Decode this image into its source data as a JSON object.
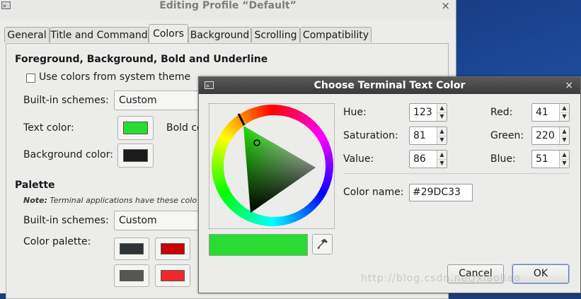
{
  "main_window": {
    "title": "Editing Profile “Default”",
    "close_glyph": "×",
    "tabs": [
      {
        "label": "General"
      },
      {
        "label": "Title and Command"
      },
      {
        "label": "Colors"
      },
      {
        "label": "Background"
      },
      {
        "label": "Scrolling"
      },
      {
        "label": "Compatibility"
      }
    ],
    "active_tab": "Colors",
    "section_fg": "Foreground, Background, Bold and Underline",
    "use_system_colors": {
      "label": "Use colors from system theme",
      "checked": false
    },
    "builtin_schemes_label": "Built-in schemes:",
    "builtin_schemes_value": "Custom",
    "text_color_label": "Text color:",
    "text_color": "#29DC33",
    "bold_label": "Bold co",
    "background_color_label": "Background color:",
    "background_color": "#1b1b1b",
    "palette_heading": "Palette",
    "palette_note_prefix": "Note:",
    "palette_note": " Terminal applications have these colo",
    "palette_schemes_label": "Built-in schemes:",
    "palette_schemes_value": "Custom",
    "color_palette_label": "Color palette:",
    "palette_colors": [
      "#2e3436",
      "#cc0000",
      "#555753",
      "#ef2929"
    ]
  },
  "dialog": {
    "title": "Choose Terminal Text Color",
    "close_glyph": "×",
    "fields": {
      "hue": {
        "label": "Hue:",
        "value": "123"
      },
      "saturation": {
        "label": "Saturation:",
        "value": "81"
      },
      "value": {
        "label": "Value:",
        "value": "86"
      },
      "red": {
        "label": "Red:",
        "value": "41"
      },
      "green": {
        "label": "Green:",
        "value": "220"
      },
      "blue": {
        "label": "Blue:",
        "value": "51"
      }
    },
    "color_name_label": "Color name:",
    "color_name": "#29DC33",
    "current_color": "#29DC33",
    "cancel_label": "Cancel",
    "ok_label": "OK",
    "icons": [
      "terminal-icon",
      "close-icon",
      "eyedropper-icon",
      "spin-up-icon",
      "spin-down-icon"
    ]
  },
  "watermark": "http://blog.csdn.net/xiaoliao"
}
